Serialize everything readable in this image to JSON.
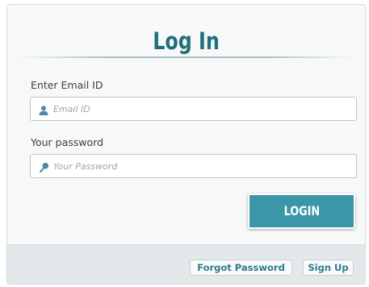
{
  "form": {
    "title": "Log In",
    "email": {
      "label": "Enter Email ID",
      "placeholder": "Email ID",
      "value": "",
      "icon": "user-icon"
    },
    "password": {
      "label": "Your password",
      "placeholder": "Your Password",
      "value": "",
      "icon": "key-icon"
    },
    "submit_label": "LOGIN"
  },
  "footer": {
    "forgot_password_label": "Forgot Password",
    "sign_up_label": "Sign Up"
  },
  "colors": {
    "accent": "#3a96a8",
    "title": "#1f6f7c",
    "link": "#2d7b8b",
    "footer_bg": "#e3e9ea"
  }
}
